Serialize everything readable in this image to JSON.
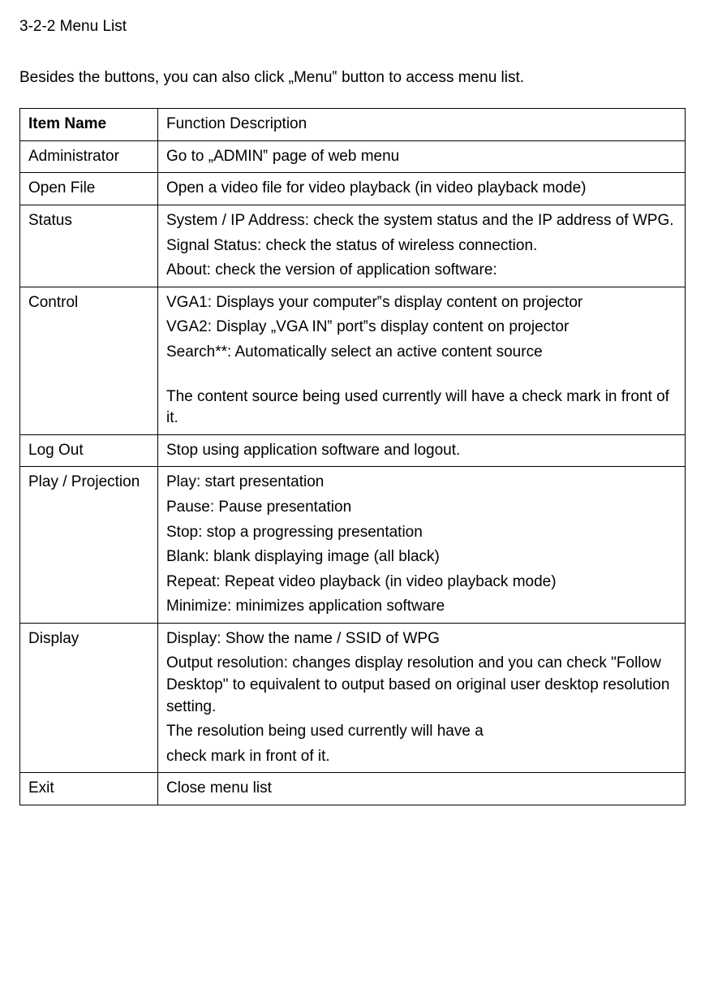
{
  "heading": "3-2-2 Menu List",
  "intro": "Besides the buttons, you can also click „Menu‟ button to access menu list.",
  "table": {
    "header": {
      "item_name": "Item Name",
      "function_description": "Function Description"
    },
    "rows": [
      {
        "name": "Administrator",
        "desc": [
          "Go to „ADMIN‟ page of web menu"
        ]
      },
      {
        "name": "Open File",
        "desc": [
          "Open a video file for video playback (in video playback mode)"
        ]
      },
      {
        "name": "Status",
        "desc": [
          "System / IP Address: check the system status and the IP address of WPG.",
          "Signal Status: check the status of wireless connection.",
          "About: check the version of application software:"
        ]
      },
      {
        "name": "Control",
        "desc": [
          "VGA1: Displays your computer‟s display content on projector",
          "VGA2: Display „VGA IN‟ port‟s display content on projector",
          "Search**: Automatically select an active content source",
          "",
          "The content source being used currently will have a check mark in front of it."
        ]
      },
      {
        "name": "Log Out",
        "desc": [
          "Stop using application software and logout."
        ]
      },
      {
        "name": "Play / Projection",
        "desc": [
          "Play: start presentation",
          "Pause: Pause presentation",
          "Stop: stop a progressing presentation",
          "Blank: blank displaying image (all black)",
          "Repeat: Repeat video playback (in video playback mode)",
          "Minimize: minimizes application software"
        ]
      },
      {
        "name": "Display",
        "desc": [
          "Display: Show the name / SSID of WPG",
          "Output resolution: changes display resolution and you can check \"Follow Desktop\" to equivalent to output based on original user desktop resolution setting.",
          "The resolution being used currently will have a",
          "check mark in front of it."
        ]
      },
      {
        "name": "Exit",
        "desc": [
          "Close menu list"
        ]
      }
    ]
  }
}
